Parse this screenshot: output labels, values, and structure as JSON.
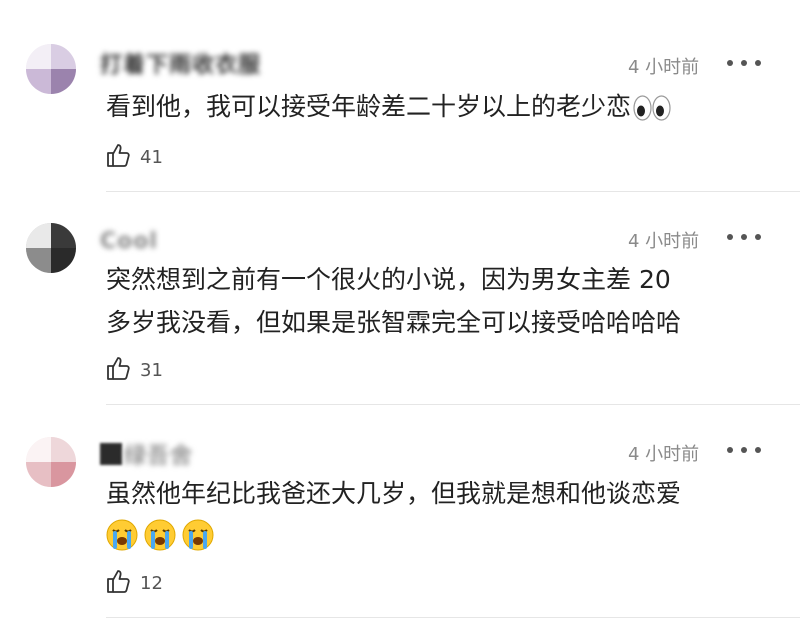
{
  "comments": [
    {
      "username": "打着下雨收衣服",
      "time": "4 小时前",
      "lines": [
        "看到他，我可以接受年龄差二十岁以上的老少恋"
      ],
      "emoji_suffix": "eyes-emoji",
      "likes": "41"
    },
    {
      "username": "Cool",
      "time": "4 小时前",
      "lines": [
        "突然想到之前有一个很火的小说，因为男女主差 20",
        "多岁我没看，但如果是张智霖完全可以接受哈哈哈哈"
      ],
      "likes": "31"
    },
    {
      "username": "绿吾舍",
      "time": "4 小时前",
      "lines": [
        "虽然他年纪比我爸还大几岁，但我就是想和他谈恋爱"
      ],
      "emoji_line": [
        "loudly-crying-face-emoji",
        "loudly-crying-face-emoji",
        "loudly-crying-face-emoji"
      ],
      "likes": "12"
    }
  ],
  "icons": {
    "like": "thumbs-up-outline-icon",
    "more": "more-dots-icon"
  },
  "colors": {
    "text": "#222222",
    "meta": "#8a8a8a",
    "divider": "#e6e6e6"
  }
}
